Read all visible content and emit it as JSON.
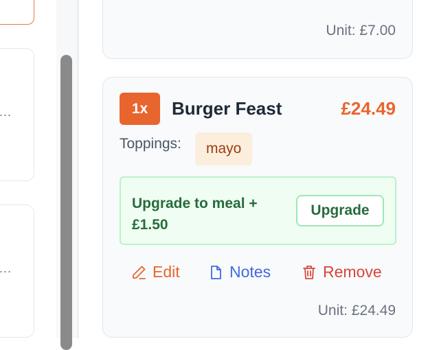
{
  "left_panel": {
    "cards": [
      {
        "ellipsis": "..."
      },
      {
        "ellipsis": "..."
      }
    ]
  },
  "prev_item": {
    "unit_price": "Unit: £7.00"
  },
  "item": {
    "quantity": "1x",
    "name": "Burger Feast",
    "price": "£24.49",
    "toppings_label": "Toppings:",
    "toppings": [
      "mayo"
    ],
    "upgrade_text": "Upgrade to meal + £1.50",
    "upgrade_button": "Upgrade",
    "actions": {
      "edit": "Edit",
      "notes": "Notes",
      "remove": "Remove"
    },
    "unit_price": "Unit: £24.49"
  },
  "colors": {
    "accent": "#e8652e",
    "notes_blue": "#4169e1",
    "remove_red": "#d9453a",
    "upgrade_green": "#276b3d"
  },
  "icons": {
    "edit": "pencil-icon",
    "notes": "document-icon",
    "remove": "trash-icon"
  }
}
